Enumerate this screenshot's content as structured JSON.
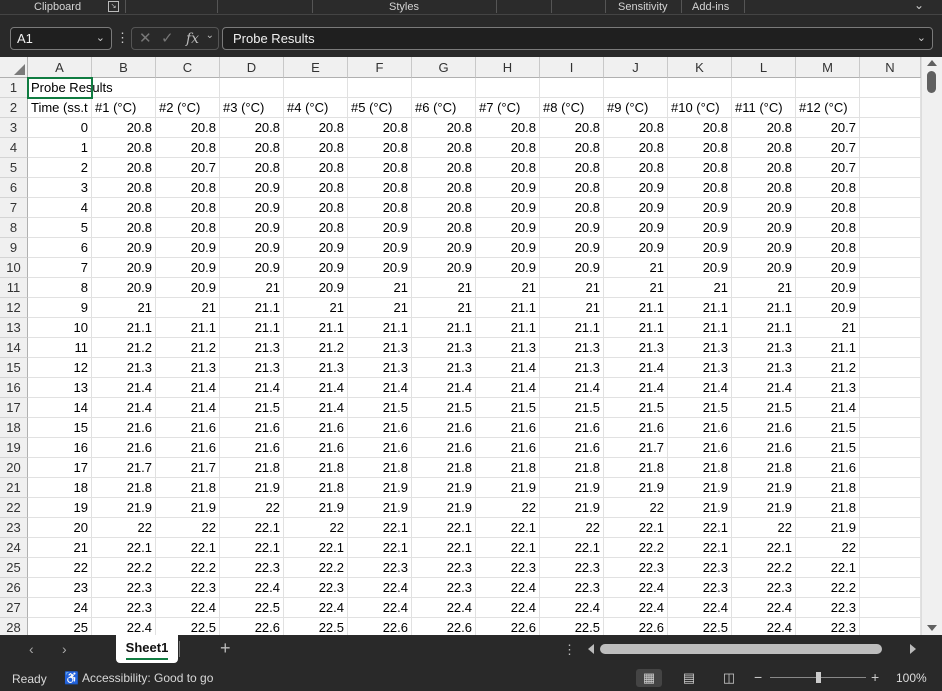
{
  "ribbon": {
    "groups": [
      "Clipboard",
      "Styles",
      "Sensitivity",
      "Add-ins"
    ]
  },
  "formula_bar": {
    "name_box": "A1",
    "fx": "fx",
    "content": "Probe Results"
  },
  "columns": [
    "A",
    "B",
    "C",
    "D",
    "E",
    "F",
    "G",
    "H",
    "I",
    "J",
    "K",
    "L",
    "M",
    "N"
  ],
  "rows": [
    "1",
    "2",
    "3",
    "4",
    "5",
    "6",
    "7",
    "8",
    "9",
    "10",
    "11",
    "12",
    "13",
    "14",
    "15",
    "16",
    "17",
    "18",
    "19",
    "20",
    "21",
    "22",
    "23",
    "24",
    "25",
    "26",
    "27",
    "28"
  ],
  "sheet": {
    "title": "Probe Results",
    "headers": [
      "Time (ss.t",
      "#1 (°C)",
      "#2 (°C)",
      "#3 (°C)",
      "#4 (°C)",
      "#5 (°C)",
      "#6 (°C)",
      "#7 (°C)",
      "#8 (°C)",
      "#9 (°C)",
      "#10 (°C)",
      "#11 (°C)",
      "#12 (°C)"
    ],
    "data": [
      [
        "0",
        "20.8",
        "20.8",
        "20.8",
        "20.8",
        "20.8",
        "20.8",
        "20.8",
        "20.8",
        "20.8",
        "20.8",
        "20.8",
        "20.7"
      ],
      [
        "1",
        "20.8",
        "20.8",
        "20.8",
        "20.8",
        "20.8",
        "20.8",
        "20.8",
        "20.8",
        "20.8",
        "20.8",
        "20.8",
        "20.7"
      ],
      [
        "2",
        "20.8",
        "20.7",
        "20.8",
        "20.8",
        "20.8",
        "20.8",
        "20.8",
        "20.8",
        "20.8",
        "20.8",
        "20.8",
        "20.7"
      ],
      [
        "3",
        "20.8",
        "20.8",
        "20.9",
        "20.8",
        "20.8",
        "20.8",
        "20.9",
        "20.8",
        "20.9",
        "20.8",
        "20.8",
        "20.8"
      ],
      [
        "4",
        "20.8",
        "20.8",
        "20.9",
        "20.8",
        "20.8",
        "20.8",
        "20.9",
        "20.8",
        "20.9",
        "20.9",
        "20.9",
        "20.8"
      ],
      [
        "5",
        "20.8",
        "20.8",
        "20.9",
        "20.8",
        "20.9",
        "20.8",
        "20.9",
        "20.9",
        "20.9",
        "20.9",
        "20.9",
        "20.8"
      ],
      [
        "6",
        "20.9",
        "20.9",
        "20.9",
        "20.9",
        "20.9",
        "20.9",
        "20.9",
        "20.9",
        "20.9",
        "20.9",
        "20.9",
        "20.8"
      ],
      [
        "7",
        "20.9",
        "20.9",
        "20.9",
        "20.9",
        "20.9",
        "20.9",
        "20.9",
        "20.9",
        "21",
        "20.9",
        "20.9",
        "20.9"
      ],
      [
        "8",
        "20.9",
        "20.9",
        "21",
        "20.9",
        "21",
        "21",
        "21",
        "21",
        "21",
        "21",
        "21",
        "20.9"
      ],
      [
        "9",
        "21",
        "21",
        "21.1",
        "21",
        "21",
        "21",
        "21.1",
        "21",
        "21.1",
        "21.1",
        "21.1",
        "20.9"
      ],
      [
        "10",
        "21.1",
        "21.1",
        "21.1",
        "21.1",
        "21.1",
        "21.1",
        "21.1",
        "21.1",
        "21.1",
        "21.1",
        "21.1",
        "21"
      ],
      [
        "11",
        "21.2",
        "21.2",
        "21.3",
        "21.2",
        "21.3",
        "21.3",
        "21.3",
        "21.3",
        "21.3",
        "21.3",
        "21.3",
        "21.1"
      ],
      [
        "12",
        "21.3",
        "21.3",
        "21.3",
        "21.3",
        "21.3",
        "21.3",
        "21.4",
        "21.3",
        "21.4",
        "21.3",
        "21.3",
        "21.2"
      ],
      [
        "13",
        "21.4",
        "21.4",
        "21.4",
        "21.4",
        "21.4",
        "21.4",
        "21.4",
        "21.4",
        "21.4",
        "21.4",
        "21.4",
        "21.3"
      ],
      [
        "14",
        "21.4",
        "21.4",
        "21.5",
        "21.4",
        "21.5",
        "21.5",
        "21.5",
        "21.5",
        "21.5",
        "21.5",
        "21.5",
        "21.4"
      ],
      [
        "15",
        "21.6",
        "21.6",
        "21.6",
        "21.6",
        "21.6",
        "21.6",
        "21.6",
        "21.6",
        "21.6",
        "21.6",
        "21.6",
        "21.5"
      ],
      [
        "16",
        "21.6",
        "21.6",
        "21.6",
        "21.6",
        "21.6",
        "21.6",
        "21.6",
        "21.6",
        "21.7",
        "21.6",
        "21.6",
        "21.5"
      ],
      [
        "17",
        "21.7",
        "21.7",
        "21.8",
        "21.8",
        "21.8",
        "21.8",
        "21.8",
        "21.8",
        "21.8",
        "21.8",
        "21.8",
        "21.6"
      ],
      [
        "18",
        "21.8",
        "21.8",
        "21.9",
        "21.8",
        "21.9",
        "21.9",
        "21.9",
        "21.9",
        "21.9",
        "21.9",
        "21.9",
        "21.8"
      ],
      [
        "19",
        "21.9",
        "21.9",
        "22",
        "21.9",
        "21.9",
        "21.9",
        "22",
        "21.9",
        "22",
        "21.9",
        "21.9",
        "21.8"
      ],
      [
        "20",
        "22",
        "22",
        "22.1",
        "22",
        "22.1",
        "22.1",
        "22.1",
        "22",
        "22.1",
        "22.1",
        "22",
        "21.9"
      ],
      [
        "21",
        "22.1",
        "22.1",
        "22.1",
        "22.1",
        "22.1",
        "22.1",
        "22.1",
        "22.1",
        "22.2",
        "22.1",
        "22.1",
        "22"
      ],
      [
        "22",
        "22.2",
        "22.2",
        "22.3",
        "22.2",
        "22.3",
        "22.3",
        "22.3",
        "22.3",
        "22.3",
        "22.3",
        "22.2",
        "22.1"
      ],
      [
        "23",
        "22.3",
        "22.3",
        "22.4",
        "22.3",
        "22.4",
        "22.3",
        "22.4",
        "22.3",
        "22.4",
        "22.3",
        "22.3",
        "22.2"
      ],
      [
        "24",
        "22.3",
        "22.4",
        "22.5",
        "22.4",
        "22.4",
        "22.4",
        "22.4",
        "22.4",
        "22.4",
        "22.4",
        "22.4",
        "22.3"
      ],
      [
        "25",
        "22.4",
        "22.5",
        "22.6",
        "22.5",
        "22.6",
        "22.6",
        "22.6",
        "22.5",
        "22.6",
        "22.5",
        "22.4",
        "22.3"
      ]
    ]
  },
  "tabs": {
    "sheet_name": "Sheet1",
    "add": "+"
  },
  "status": {
    "ready": "Ready",
    "accessibility": "Accessibility: Good to go",
    "zoom": "100%",
    "zoom_minus": "−",
    "zoom_plus": "+"
  },
  "icons": {
    "accessibility": "accessibility-icon",
    "normal_view": "normal-view-icon",
    "page_layout": "page-layout-icon",
    "page_break": "page-break-preview-icon"
  },
  "colors": {
    "accent": "#107c41",
    "chrome": "#292929",
    "grid_header": "#f0f0f0"
  }
}
